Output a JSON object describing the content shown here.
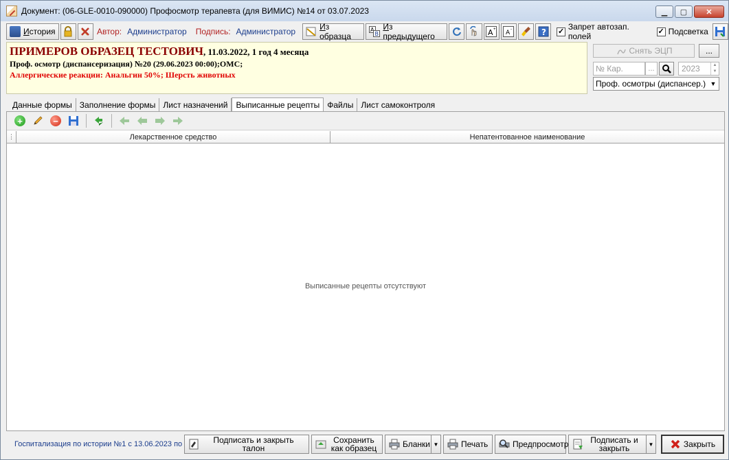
{
  "window": {
    "title": "Документ: (06-GLE-0010-090000) Профосмотр терапевта (для ВИМИС) №14 от 03.07.2023",
    "controls": [
      "minimize",
      "maximize",
      "close"
    ]
  },
  "toolbar": {
    "history_label": "История",
    "author_label": "Автор:",
    "author_value": "Администратор",
    "signature_label": "Подпись:",
    "signature_value": "Администратор",
    "from_template_label": "Из образца",
    "from_previous_label": "Из предыдущего",
    "ban_autofill_label": "Запрет автозап. полей",
    "ban_autofill_checked": true,
    "highlight_label": "Подсветка",
    "highlight_checked": true
  },
  "patient": {
    "name": "ПРИМЕРОВ ОБРАЗЕЦ ТЕСТОВИЧ",
    "dob_age": ", 11.03.2022, 1 год 4 месяца",
    "exam": "Проф. осмотр (диспансеризация) №20 (29.06.2023 00:00);ОМС;",
    "allergies": "Аллергические реакции: Анальгин 50%; Шерсть животных"
  },
  "right_panel": {
    "remove_ecp_label": "Снять ЭЦП",
    "dots_label": "...",
    "card_placeholder": "№ Кар.",
    "card_dots": "...",
    "year": "2023",
    "exam_type": "Проф. осмотры (диспансер.)"
  },
  "tabs": [
    {
      "label": "Данные формы",
      "active": false
    },
    {
      "label": "Заполнение формы",
      "active": false
    },
    {
      "label": "Лист назначений",
      "active": false
    },
    {
      "label": "Выписанные рецепты",
      "active": true
    },
    {
      "label": "Файлы",
      "active": false
    },
    {
      "label": "Лист самоконтроля",
      "active": false
    }
  ],
  "grid": {
    "columns": [
      "Лекарственное средство",
      "Непатентованное наименование"
    ],
    "empty_message": "Выписанные рецепты отсутствуют"
  },
  "bottom": {
    "hospitalization": "Госпитализация по истории №1 с 13.06.2023 по",
    "sign_close_ticket": "Подписать и закрыть талон",
    "save_as_template": "Сохранить как образец",
    "forms": "Бланки",
    "print": "Печать",
    "preview": "Предпросмотр",
    "sign_and_close": "Подписать и закрыть",
    "close": "Закрыть"
  },
  "colors": {
    "patient_bg": "#ffffe1",
    "name_color": "#8b0000",
    "allergy_color": "#e00000",
    "meta_value_color": "#1a3c8c"
  }
}
